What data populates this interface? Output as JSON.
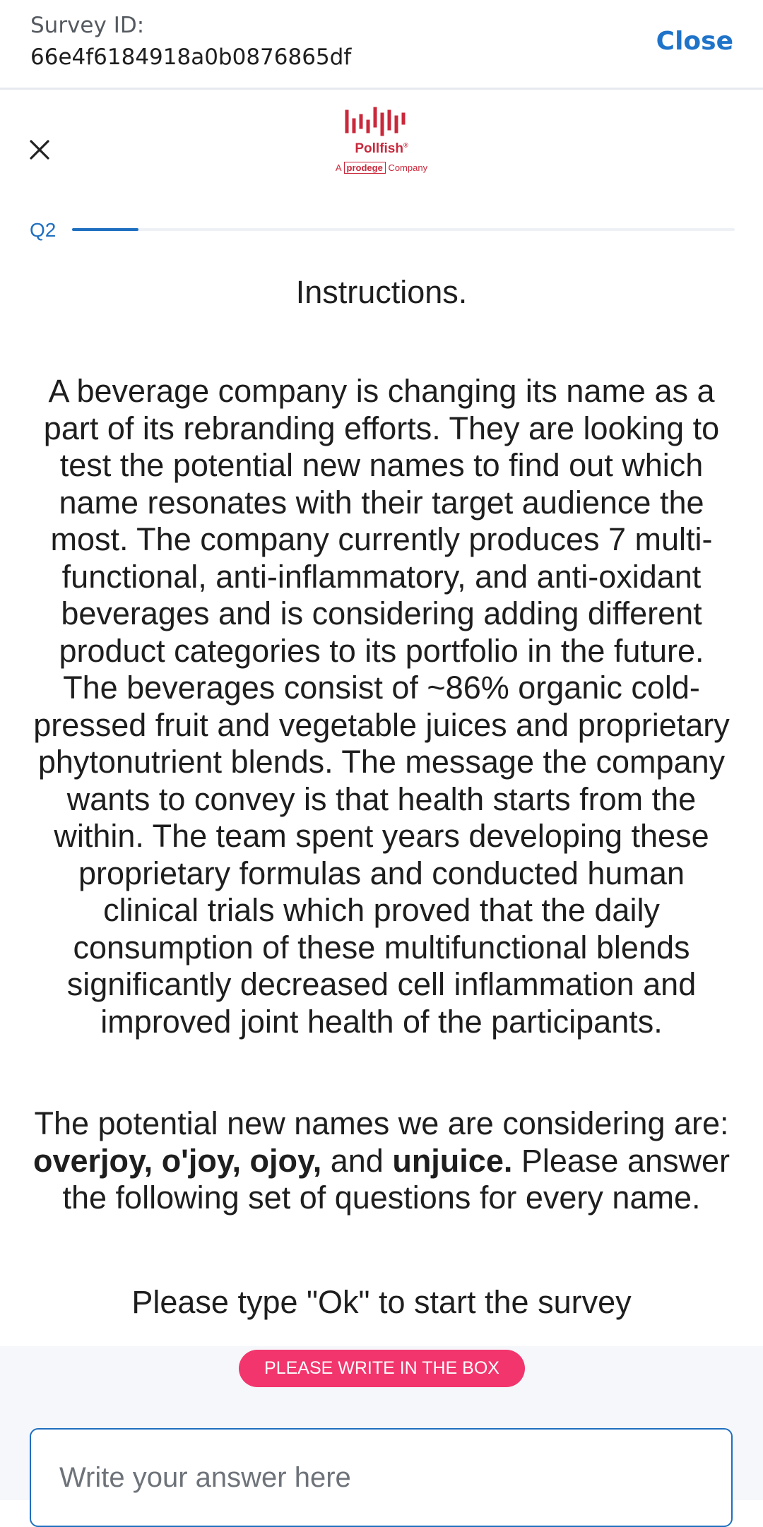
{
  "header": {
    "survey_id_label": "Survey ID:",
    "survey_id_value": "66e4f6184918a0b0876865df",
    "close_label": "Close"
  },
  "brand": {
    "name": "Pollfish",
    "registered": "®",
    "sub_prefix": "A",
    "sub_brand": "prodege",
    "sub_suffix": "Company",
    "color": "#c9283b"
  },
  "progress": {
    "question_label": "Q2",
    "fraction": 0.1
  },
  "content": {
    "title": "Instructions.",
    "paragraph1": "A beverage company is changing its name as a part of its rebranding efforts. They are looking to test the potential new names to find out which name resonates with their target audience the most. The company currently produces 7 multi-functional, anti-inflammatory, and anti-oxidant beverages and is considering adding different product categories to its portfolio in the future. The beverages consist of ~86% organic cold-pressed fruit and vegetable juices and proprietary phytonutrient blends. The message the company wants to convey is that health starts from the within. The team spent years developing these proprietary formulas and conducted human clinical trials which proved that the daily consumption of these multifunctional blends significantly decreased cell inflammation and improved joint health of the participants.",
    "paragraph2": {
      "lead": "The potential new names we are considering are: ",
      "names_bold": "overjoy, o'joy, ojoy,",
      "and": " and ",
      "last_bold": "unjuice.",
      "tail": " Please answer the following set of questions for every name."
    },
    "paragraph3": "Please type \"Ok\" to start the survey"
  },
  "answer": {
    "badge": "PLEASE WRITE IN THE BOX",
    "placeholder": "Write your answer here",
    "value": ""
  },
  "colors": {
    "accent": "#1f6fc0",
    "badge": "#f2356c"
  }
}
